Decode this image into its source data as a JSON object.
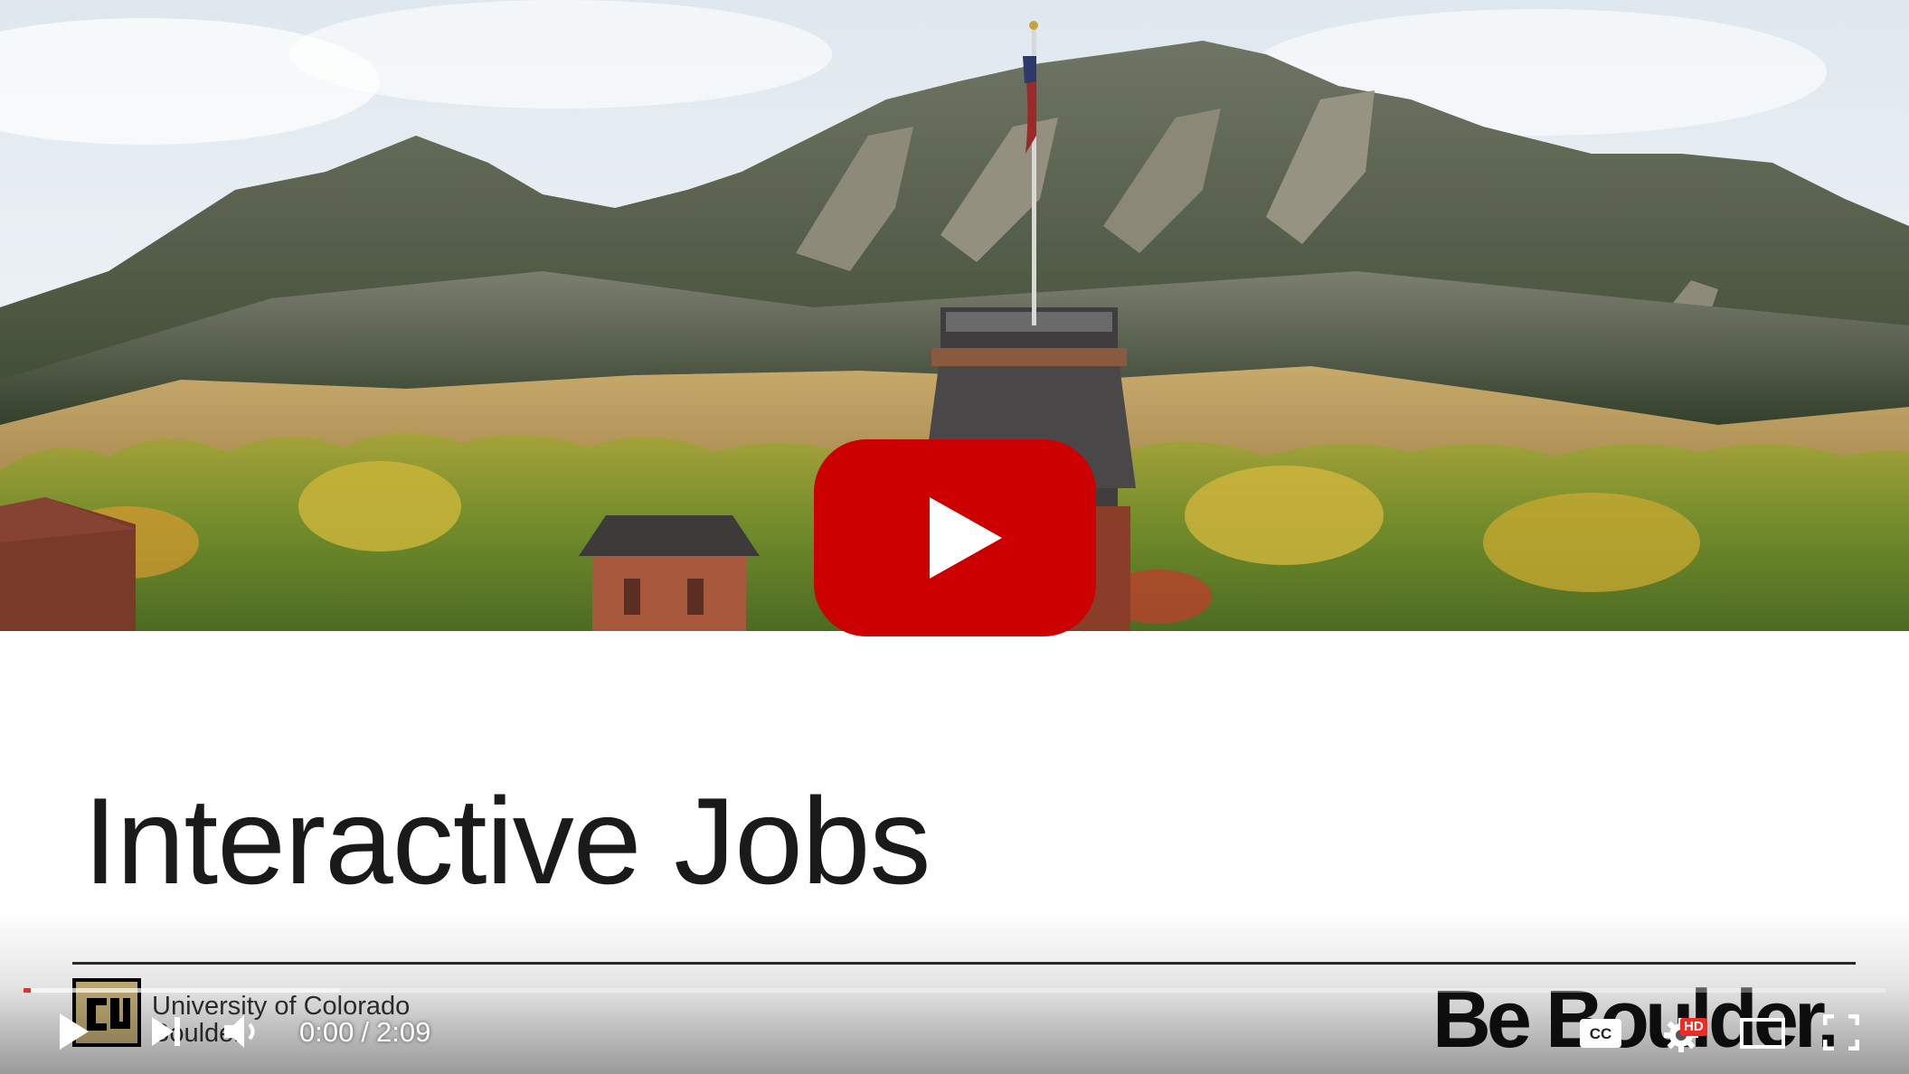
{
  "slide": {
    "title": "Interactive Jobs"
  },
  "branding": {
    "university_line1": "University of Colorado",
    "university_line2": "Boulder",
    "tagline": "Be Boulder."
  },
  "player": {
    "current_time": "0:00",
    "separator": "/",
    "duration": "2:09",
    "hd_badge": "HD",
    "progress_played_fraction": 0.0,
    "progress_loaded_fraction": 0.17,
    "accent_color": "#f12b24",
    "icons": {
      "big_play": "youtube-play-icon",
      "play": "play-icon",
      "next": "next-icon",
      "volume": "volume-icon",
      "captions": "cc-icon",
      "settings": "gear-icon",
      "theater": "theater-mode-icon",
      "fullscreen": "fullscreen-icon"
    }
  }
}
